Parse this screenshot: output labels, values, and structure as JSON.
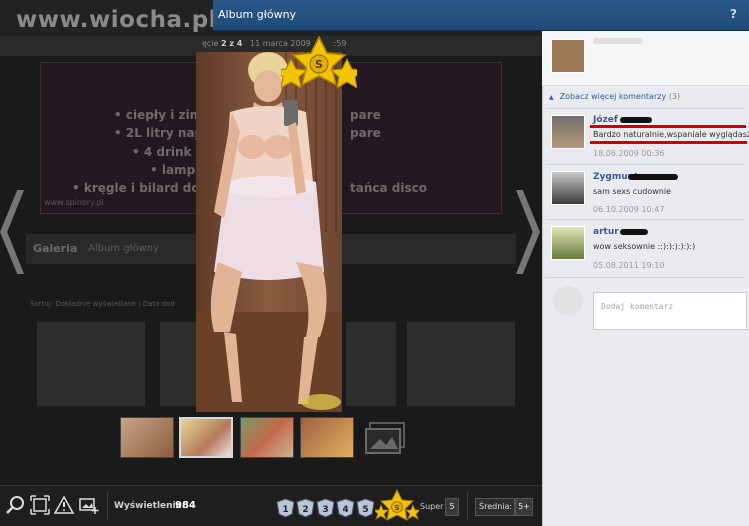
{
  "site": {
    "logo": "www.wiocha.pl"
  },
  "window": {
    "title": "Album główny",
    "help": "?"
  },
  "photo_nav": {
    "position_prefix": "ęcie",
    "position": "2 z 4",
    "date": "11 marca 2009",
    "time_fragment": ":59"
  },
  "background": {
    "banner_lines": [
      "• ciepły i zim",
      "pare",
      "• 2L litry nap",
      "pare",
      "• 4 drink",
      "• lamp",
      "• kręgle i bilard do",
      "tańca disco"
    ],
    "banner_small": "www.spinory.pl",
    "gallery_title": "Galeria",
    "gallery_album": "Album główny",
    "sort_text": "Sortuj: Dokładnie wyświetlane | Data dod"
  },
  "comments": {
    "more_label": "Zobacz więcej komentarzy",
    "more_count": "(3)",
    "items": [
      {
        "author": "Józef",
        "text": "Bardzo naturalnie,wspaniale wyglądasz.",
        "date": "18.06.2009 00:36"
      },
      {
        "author": "Zygmunt",
        "text": "sam sexs cudownie",
        "date": "06.10.2009 10:47"
      },
      {
        "author": "artur",
        "text": "wow seksownie ::):):):):):)",
        "date": "05.08.2011 19:10"
      }
    ],
    "add_placeholder": "Dodaj komentarz"
  },
  "stats": {
    "views_label": "Wyświetlenia:",
    "views": "984",
    "super_label": "Super",
    "super_count": "5",
    "avg_label": "Średnia:",
    "avg_value": "5+",
    "rating_badges": [
      "1",
      "2",
      "3",
      "4",
      "5"
    ]
  },
  "icons": {
    "rating_star": "S",
    "tools": [
      "zoom-icon",
      "fullscreen-icon",
      "report-icon",
      "add-photo-icon"
    ]
  },
  "colors": {
    "header": "#1f4a75",
    "link": "#3b5998",
    "highlight": "#d40000",
    "star": "#f2c500"
  }
}
